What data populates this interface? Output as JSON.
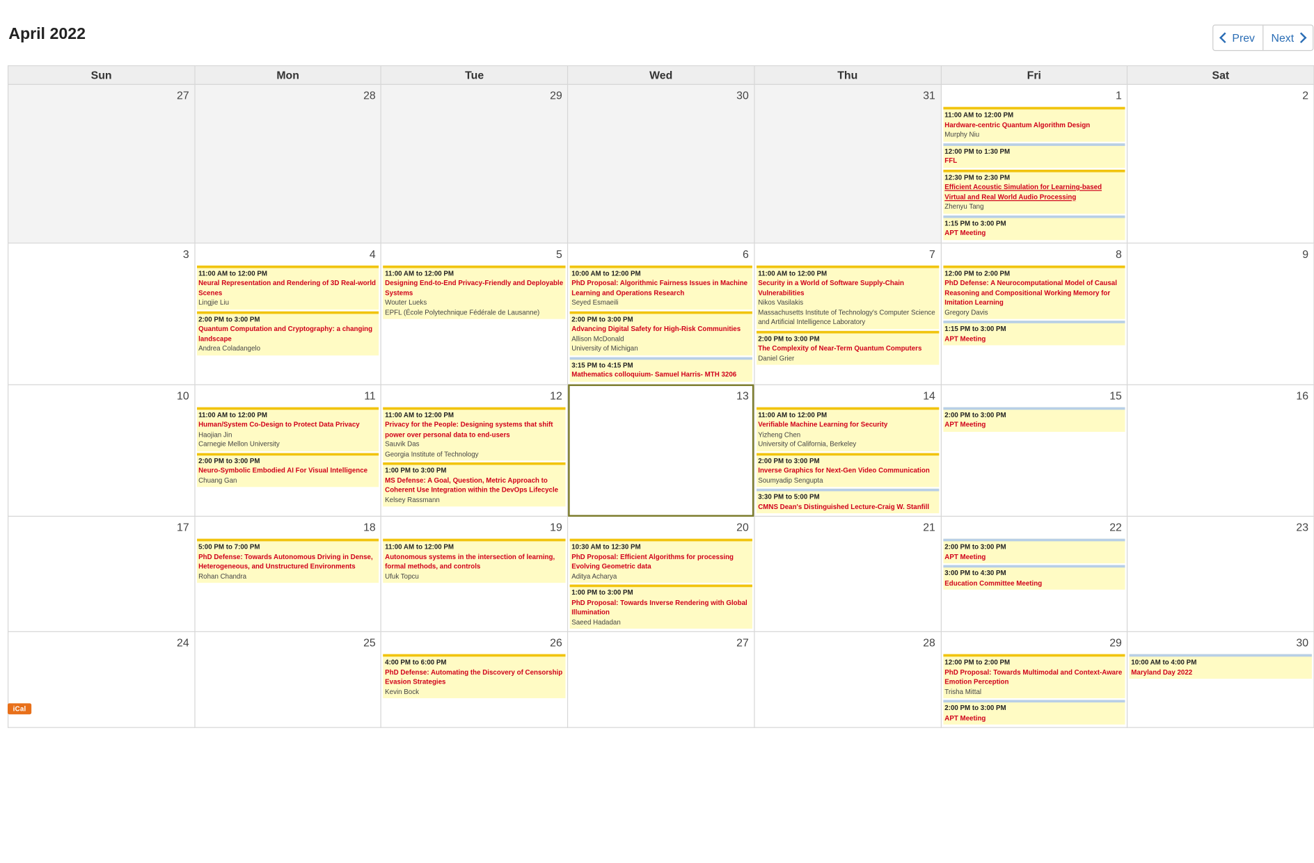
{
  "header": {
    "title": "April 2022",
    "prev_label": "Prev",
    "next_label": "Next"
  },
  "weekdays": [
    "Sun",
    "Mon",
    "Tue",
    "Wed",
    "Thu",
    "Fri",
    "Sat"
  ],
  "weeks": [
    {
      "height": 175,
      "days": [
        {
          "num": "27",
          "other": true,
          "events": []
        },
        {
          "num": "28",
          "other": true,
          "events": []
        },
        {
          "num": "29",
          "other": true,
          "events": []
        },
        {
          "num": "30",
          "other": true,
          "events": []
        },
        {
          "num": "31",
          "other": true,
          "events": []
        },
        {
          "num": "1",
          "events": [
            {
              "time": "11:00 AM to 12:00 PM",
              "title": "Hardware-centric Quantum Algorithm Design",
              "people": [
                "Murphy Niu"
              ]
            },
            {
              "time": "12:00 PM to 1:30 PM",
              "title": "FFL",
              "people": [],
              "color": "blue"
            },
            {
              "time": "12:30 PM to 2:30 PM",
              "title": "Efficient Acoustic Simulation for Learning-based Virtual and Real World Audio Processing",
              "people": [
                "Zhenyu Tang"
              ],
              "underline": true
            },
            {
              "time": "1:15 PM to 3:00 PM",
              "title": "APT Meeting",
              "people": [],
              "color": "blue"
            }
          ]
        },
        {
          "num": "2",
          "events": []
        }
      ]
    },
    {
      "height": 160,
      "days": [
        {
          "num": "3",
          "events": []
        },
        {
          "num": "4",
          "events": [
            {
              "time": "11:00 AM to 12:00 PM",
              "title": "Neural Representation and Rendering of 3D Real-world Scenes",
              "people": [
                "Lingjie Liu"
              ]
            },
            {
              "time": "2:00 PM to 3:00 PM",
              "title": "Quantum Computation and Cryptography: a changing landscape",
              "people": [
                "Andrea Coladangelo"
              ]
            }
          ]
        },
        {
          "num": "5",
          "events": [
            {
              "time": "11:00 AM to 12:00 PM",
              "title": "Designing End-to-End Privacy-Friendly and Deployable Systems",
              "people": [
                "Wouter Lueks",
                "EPFL (École Polytechnique Fédérale de Lausanne)"
              ]
            }
          ]
        },
        {
          "num": "6",
          "events": [
            {
              "time": "10:00 AM to 12:00 PM",
              "title": "PhD Proposal: Algorithmic Fairness Issues in Machine Learning and Operations Research",
              "people": [
                "Seyed Esmaeili"
              ]
            },
            {
              "time": "2:00 PM to 3:00 PM",
              "title": "Advancing Digital Safety for High-Risk Communities",
              "people": [
                "Allison McDonald",
                "University of Michigan"
              ]
            },
            {
              "time": "3:15 PM to 4:15 PM",
              "title": "Mathematics colloquium- Samuel Harris- MTH 3206",
              "people": [],
              "color": "blue"
            }
          ]
        },
        {
          "num": "7",
          "events": [
            {
              "time": "11:00 AM to 12:00 PM",
              "title": "Security in a World of Software Supply-Chain Vulnerabilities",
              "people": [
                "Nikos Vasilakis",
                "Massachusetts Institute of Technology's Computer Science and Artificial Intelligence Laboratory"
              ]
            },
            {
              "time": "2:00 PM to 3:00 PM",
              "title": "The Complexity of Near-Term Quantum Computers",
              "people": [
                "Daniel Grier"
              ]
            }
          ]
        },
        {
          "num": "8",
          "events": [
            {
              "time": "12:00 PM to 2:00 PM",
              "title": "PhD Defense: A Neurocomputational Model of Causal Reasoning and Compositional Working Memory for Imitation Learning",
              "people": [
                "Gregory Davis"
              ]
            },
            {
              "time": "1:15 PM to 3:00 PM",
              "title": "APT Meeting",
              "people": [],
              "color": "blue"
            }
          ]
        },
        {
          "num": "9",
          "events": []
        }
      ]
    },
    {
      "height": 148,
      "days": [
        {
          "num": "10",
          "events": []
        },
        {
          "num": "11",
          "events": [
            {
              "time": "11:00 AM to 12:00 PM",
              "title": "Human/System Co-Design to Protect Data Privacy",
              "people": [
                "Haojian Jin",
                "Carnegie Mellon University"
              ]
            },
            {
              "time": "2:00 PM to 3:00 PM",
              "title": "Neuro-Symbolic Embodied AI For Visual Intelligence",
              "people": [
                "Chuang Gan"
              ]
            }
          ]
        },
        {
          "num": "12",
          "events": [
            {
              "time": "11:00 AM to 12:00 PM",
              "title": "Privacy for the People: Designing systems that shift power over personal data to end-users",
              "people": [
                "Sauvik Das",
                "Georgia Institute of Technology"
              ]
            },
            {
              "time": "1:00 PM to 3:00 PM",
              "title": "MS Defense: A Goal, Question, Metric Approach to Coherent Use Integration within the DevOps Lifecycle",
              "people": [
                "Kelsey Rassmann"
              ]
            }
          ]
        },
        {
          "num": "13",
          "today": true,
          "events": []
        },
        {
          "num": "14",
          "events": [
            {
              "time": "11:00 AM to 12:00 PM",
              "title": "Verifiable Machine Learning for Security",
              "people": [
                "Yizheng Chen",
                "University of California, Berkeley"
              ]
            },
            {
              "time": "2:00 PM to 3:00 PM",
              "title": "Inverse Graphics for Next-Gen Video Communication",
              "people": [
                "Soumyadip Sengupta"
              ]
            },
            {
              "time": "3:30 PM to 5:00 PM",
              "title": "CMNS Dean's Distinguished Lecture-Craig W. Stanfill",
              "people": [],
              "color": "blue"
            }
          ]
        },
        {
          "num": "15",
          "events": [
            {
              "time": "2:00 PM to 3:00 PM",
              "title": "APT Meeting",
              "people": [],
              "color": "blue"
            }
          ]
        },
        {
          "num": "16",
          "events": []
        }
      ]
    },
    {
      "height": 132,
      "days": [
        {
          "num": "17",
          "events": []
        },
        {
          "num": "18",
          "events": [
            {
              "time": "5:00 PM to 7:00 PM",
              "title": "PhD Defense: Towards Autonomous Driving in Dense, Heterogeneous, and Unstructured Environments",
              "people": [
                "Rohan Chandra"
              ]
            }
          ]
        },
        {
          "num": "19",
          "events": [
            {
              "time": "11:00 AM to 12:00 PM",
              "title": "Autonomous systems in the intersection of learning, formal methods, and controls",
              "people": [
                "Ufuk Topcu"
              ]
            }
          ]
        },
        {
          "num": "20",
          "events": [
            {
              "time": "10:30 AM to 12:30 PM",
              "title": "PhD Proposal: Efficient Algorithms for processing Evolving Geometric data",
              "people": [
                "Aditya Acharya"
              ]
            },
            {
              "time": "1:00 PM to 3:00 PM",
              "title": "PhD Proposal: Towards Inverse Rendering with Global Illumination",
              "people": [
                "Saeed Hadadan"
              ]
            }
          ]
        },
        {
          "num": "21",
          "events": []
        },
        {
          "num": "22",
          "events": [
            {
              "time": "2:00 PM to 3:00 PM",
              "title": "APT Meeting",
              "people": [],
              "color": "blue"
            },
            {
              "time": "3:00 PM to 4:30 PM",
              "title": "Education Committee Meeting",
              "people": [],
              "color": "blue"
            }
          ]
        },
        {
          "num": "23",
          "events": []
        }
      ]
    },
    {
      "height": 107,
      "days": [
        {
          "num": "24",
          "events": []
        },
        {
          "num": "25",
          "events": []
        },
        {
          "num": "26",
          "events": [
            {
              "time": "4:00 PM to 6:00 PM",
              "title": "PhD Defense: Automating the Discovery of Censorship Evasion Strategies",
              "people": [
                "Kevin Bock"
              ]
            }
          ]
        },
        {
          "num": "27",
          "events": []
        },
        {
          "num": "28",
          "events": []
        },
        {
          "num": "29",
          "events": [
            {
              "time": "12:00 PM to 2:00 PM",
              "title": "PhD Proposal: Towards Multimodal and Context-Aware Emotion Perception",
              "people": [
                "Trisha Mittal"
              ]
            },
            {
              "time": "2:00 PM to 3:00 PM",
              "title": "APT Meeting",
              "people": [],
              "color": "blue"
            }
          ]
        },
        {
          "num": "30",
          "events": [
            {
              "time": "10:00 AM to 4:00 PM",
              "title": "Maryland Day 2022",
              "people": [],
              "color": "blue"
            }
          ]
        }
      ]
    }
  ],
  "footer": {
    "ical_label": "iCal"
  }
}
